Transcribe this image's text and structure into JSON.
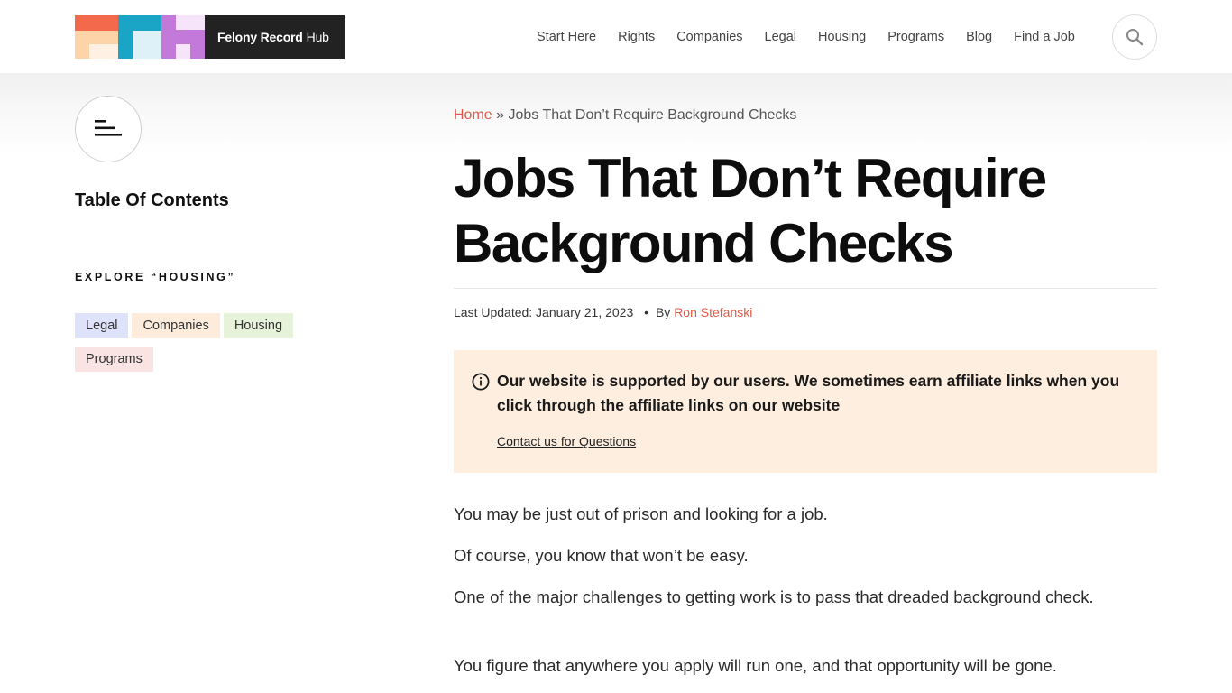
{
  "site": {
    "logo_bold": "Felony Record",
    "logo_light": "Hub"
  },
  "nav": {
    "items": [
      "Start Here",
      "Rights",
      "Companies",
      "Legal",
      "Housing",
      "Programs",
      "Blog",
      "Find a Job"
    ]
  },
  "sidebar": {
    "toc_title": "Table Of Contents",
    "explore_label": "EXPLORE “HOUSING”",
    "tags": [
      {
        "label": "Legal",
        "color": "#dfe2fb"
      },
      {
        "label": "Companies",
        "color": "#fdecdc"
      },
      {
        "label": "Housing",
        "color": "#e6f2d9"
      },
      {
        "label": "Programs",
        "color": "#f9e3e3"
      }
    ]
  },
  "article": {
    "breadcrumb_home": "Home",
    "breadcrumb_sep": "»",
    "breadcrumb_current": "Jobs That Don’t Require Background Checks",
    "title_line1": "Jobs That Don’t Require",
    "title_line2": "Background Checks",
    "last_updated": "Last Updated: January 21, 2023",
    "by": "By",
    "author": "Ron Stefanski",
    "notice_text": "Our website is supported by our users. We sometimes earn affiliate links when you click through the affiliate links on our website",
    "notice_link": "Contact us for Questions",
    "paragraphs": [
      "You may be just out of prison and looking for a job.",
      "Of course, you know that won’t be easy.",
      "One of the major challenges to getting work is to pass that dreaded background check.",
      "You figure that anywhere you apply will run one, and that opportunity will be gone."
    ]
  },
  "colors": {
    "accent": "#e05a47",
    "notice_bg": "#fdeee0"
  }
}
